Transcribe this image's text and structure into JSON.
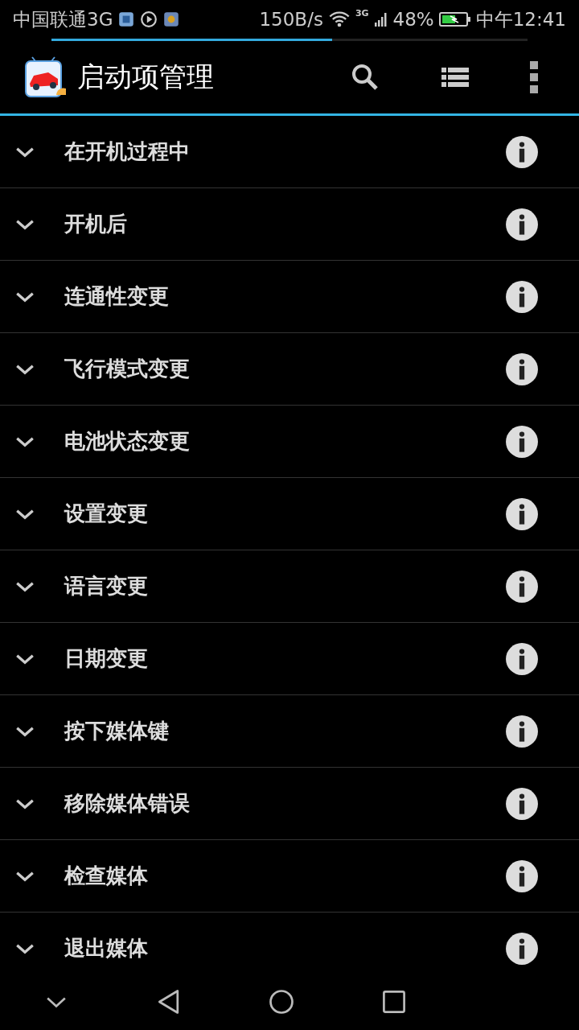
{
  "status_bar": {
    "carrier": "中国联通3G",
    "speed": "150B/s",
    "network": "3G",
    "battery": "48%",
    "time": "中午12:41"
  },
  "progress": {
    "level": 0.59
  },
  "app_bar": {
    "title": "启动项管理"
  },
  "items": [
    {
      "label": "在开机过程中"
    },
    {
      "label": "开机后"
    },
    {
      "label": "连通性变更"
    },
    {
      "label": "飞行模式变更"
    },
    {
      "label": "电池状态变更"
    },
    {
      "label": "设置变更"
    },
    {
      "label": "语言变更"
    },
    {
      "label": "日期变更"
    },
    {
      "label": "按下媒体键"
    },
    {
      "label": "移除媒体错误"
    },
    {
      "label": "检查媒体"
    },
    {
      "label": "退出媒体"
    }
  ]
}
